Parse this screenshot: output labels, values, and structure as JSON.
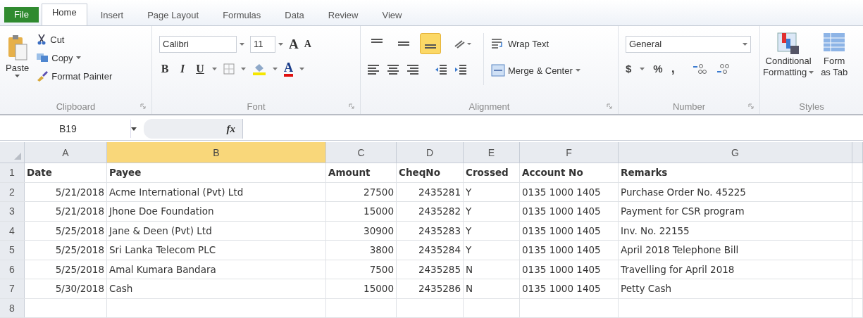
{
  "ribbon_tabs": [
    {
      "label": "File",
      "kind": "file",
      "selected": false
    },
    {
      "label": "Home",
      "kind": "tab",
      "selected": true
    },
    {
      "label": "Insert",
      "kind": "tab",
      "selected": false
    },
    {
      "label": "Page Layout",
      "kind": "tab",
      "selected": false
    },
    {
      "label": "Formulas",
      "kind": "tab",
      "selected": false
    },
    {
      "label": "Data",
      "kind": "tab",
      "selected": false
    },
    {
      "label": "Review",
      "kind": "tab",
      "selected": false
    },
    {
      "label": "View",
      "kind": "tab",
      "selected": false
    }
  ],
  "clipboard": {
    "title": "Clipboard",
    "paste": "Paste",
    "cut": "Cut",
    "copy": "Copy",
    "format_painter": "Format Painter"
  },
  "font": {
    "title": "Font",
    "family": "Calibri",
    "size": "11",
    "grow": "A",
    "shrink": "A",
    "bold": "B",
    "italic": "I",
    "underline": "U",
    "color_letter": "A"
  },
  "alignment": {
    "title": "Alignment",
    "vertical_buttons": [
      {
        "selected": false
      },
      {
        "selected": false
      },
      {
        "selected": true
      }
    ],
    "wrap_text": "Wrap Text",
    "merge_center": "Merge & Center"
  },
  "number": {
    "title": "Number",
    "format": "General",
    "currency": "$",
    "percent": "%",
    "comma": ","
  },
  "styles": {
    "title": "Styles",
    "conditional": [
      "Conditional",
      "Formatting"
    ],
    "format_table": [
      "Form",
      "as Tab"
    ]
  },
  "formula_bar": {
    "name_box": "B19",
    "fx": "fx"
  },
  "sheet": {
    "columns": [
      {
        "letter": "A",
        "selected": false,
        "numeric": true
      },
      {
        "letter": "B",
        "selected": true,
        "numeric": false
      },
      {
        "letter": "C",
        "selected": false,
        "numeric": true
      },
      {
        "letter": "D",
        "selected": false,
        "numeric": true
      },
      {
        "letter": "E",
        "selected": false,
        "numeric": false
      },
      {
        "letter": "F",
        "selected": false,
        "numeric": false
      },
      {
        "letter": "G",
        "selected": false,
        "numeric": false
      }
    ],
    "rows": [
      {
        "number": "1",
        "kind": "header",
        "cells": [
          "Date",
          "Payee",
          "Amount",
          "CheqNo",
          "Crossed",
          "Account No",
          "Remarks"
        ]
      },
      {
        "number": "2",
        "kind": "data",
        "cells": [
          "5/21/2018",
          "Acme International (Pvt) Ltd",
          "27500",
          "2435281",
          "Y",
          "0135 1000 1405",
          "Purchase Order No. 45225"
        ]
      },
      {
        "number": "3",
        "kind": "data",
        "cells": [
          "5/21/2018",
          "Jhone Doe Foundation",
          "15000",
          "2435282",
          "Y",
          "0135 1000 1405",
          "Payment for CSR program"
        ]
      },
      {
        "number": "4",
        "kind": "data",
        "cells": [
          "5/25/2018",
          "Jane & Deen (Pvt) Ltd",
          "30900",
          "2435283",
          "Y",
          "0135 1000 1405",
          "Inv. No. 22155"
        ]
      },
      {
        "number": "5",
        "kind": "data",
        "cells": [
          "5/25/2018",
          "Sri Lanka Telecom PLC",
          "3800",
          "2435284",
          "Y",
          "0135 1000 1405",
          "April 2018 Telephone Bill"
        ]
      },
      {
        "number": "6",
        "kind": "data",
        "cells": [
          "5/25/2018",
          "Amal Kumara Bandara",
          "7500",
          "2435285",
          "N",
          "0135 1000 1405",
          "Travelling for April 2018"
        ]
      },
      {
        "number": "7",
        "kind": "data",
        "cells": [
          "5/30/2018",
          "Cash",
          "15000",
          "2435286",
          "N",
          "0135 1000 1405",
          "Petty Cash"
        ]
      },
      {
        "number": "8"
      }
    ]
  }
}
